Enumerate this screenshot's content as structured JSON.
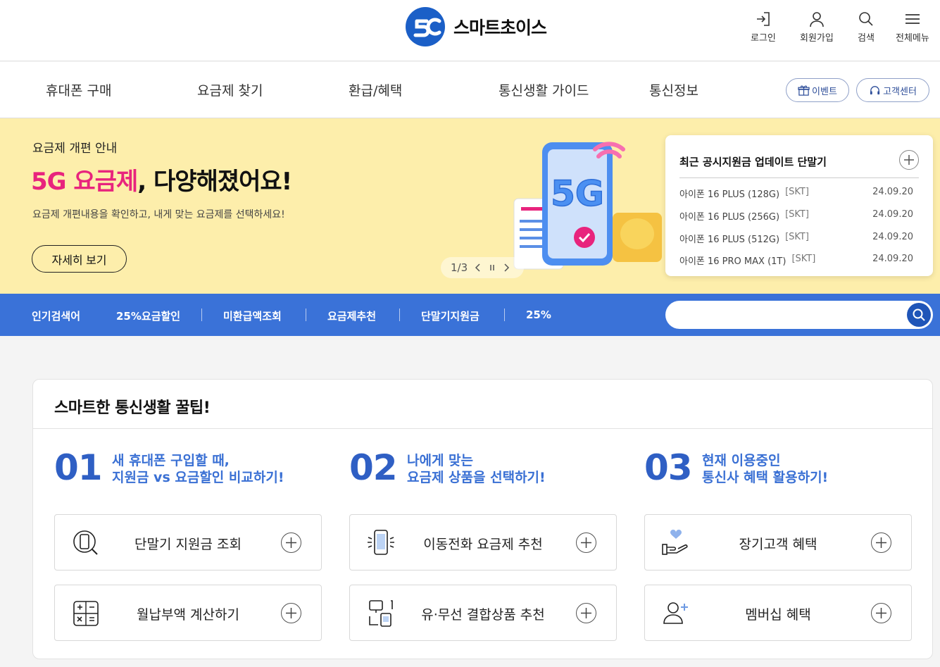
{
  "header": {
    "logo_text": "스마트초이스",
    "util": [
      {
        "label": "로그인",
        "icon": "login-icon"
      },
      {
        "label": "회원가입",
        "icon": "user-icon"
      },
      {
        "label": "검색",
        "icon": "search-icon"
      },
      {
        "label": "전체메뉴",
        "icon": "menu-icon"
      }
    ]
  },
  "gnb": {
    "items": [
      "휴대폰 구매",
      "요금제 찾기",
      "환급/혜택",
      "통신생활 가이드",
      "통신정보"
    ],
    "event_label": "이벤트",
    "support_label": "고객센터"
  },
  "hero": {
    "subtitle": "요금제 개편 안내",
    "title_highlight": "5G 요금제",
    "title_rest": ", 다양해졌어요!",
    "description": "요금제 개편내용을 확인하고, 내게 맞는 요금제를 선택하세요!",
    "button_label": "자세히 보기",
    "pager_text": "1/3",
    "art_text": "5G"
  },
  "updates": {
    "title": "최근 공시지원금 업데이트 단말기",
    "rows": [
      {
        "name": "아이폰 16 PLUS (128G)",
        "carrier": "[SKT]",
        "date": "24.09.20"
      },
      {
        "name": "아이폰 16 PLUS (256G)",
        "carrier": "[SKT]",
        "date": "24.09.20"
      },
      {
        "name": "아이폰 16 PLUS (512G)",
        "carrier": "[SKT]",
        "date": "24.09.20"
      },
      {
        "name": "아이폰 16 PRO MAX (1T)",
        "carrier": "[SKT]",
        "date": "24.09.20"
      }
    ]
  },
  "popular": {
    "label": "인기검색어",
    "keywords": [
      "25%요금할인",
      "미환급액조회",
      "요금제추천",
      "단말기지원금",
      "25%"
    ],
    "search_placeholder": ""
  },
  "tips": {
    "title": "스마트한 통신생활 꿀팁!",
    "columns": [
      {
        "num": "01",
        "line1": "새 휴대폰 구입할 때,",
        "line2": "지원금 vs 요금할인 비교하기!",
        "buttons": [
          {
            "label": "단말기 지원금 조회",
            "icon": "phone-search-icon"
          },
          {
            "label": "월납부액 계산하기",
            "icon": "calculator-icon"
          }
        ]
      },
      {
        "num": "02",
        "line1": "나에게 맞는",
        "line2": "요금제 상품을 선택하기!",
        "buttons": [
          {
            "label": "이동전화 요금제 추천",
            "icon": "mobile-phone-icon"
          },
          {
            "label": "유·무선 결합상품 추천",
            "icon": "devices-icon"
          }
        ]
      },
      {
        "num": "03",
        "line1": "현재 이용중인",
        "line2": "통신사 혜택 활용하기!",
        "buttons": [
          {
            "label": "장기고객 혜택",
            "icon": "hand-heart-icon"
          },
          {
            "label": "멤버십 혜택",
            "icon": "user-plus-icon"
          }
        ]
      }
    ]
  },
  "colors": {
    "brand_blue": "#2f5fc4",
    "hot_bar": "#3a72d8",
    "hero_bg": "#fdeeab",
    "pink": "#e8247d"
  }
}
